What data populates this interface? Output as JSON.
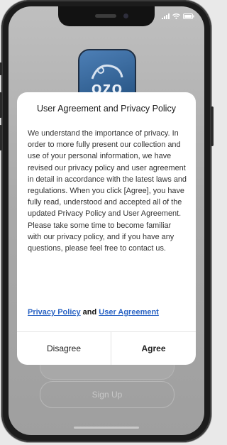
{
  "dialog": {
    "title": "User Agreement and Privacy Policy",
    "body": "We understand the importance of privacy. In order to more fully present our collection and use of your personal information, we have revised our privacy policy and user agreement in detail in accordance with the latest laws and regulations. When you click [Agree], you have fully read, understood and accepted all of the updated Privacy Policy and User Agreement. Please take some time to become familiar with our privacy policy, and if you have any questions, please feel free to contact us.",
    "privacy_link": "Privacy Policy",
    "and_text": " and ",
    "agreement_link": "User Agreement",
    "disagree_label": "Disagree",
    "agree_label": "Agree"
  },
  "background": {
    "logo_text": "ozo",
    "signup_label": "Sign Up"
  },
  "icons": {
    "signal": "signal-icon",
    "wifi": "wifi-icon",
    "battery": "battery-icon"
  }
}
